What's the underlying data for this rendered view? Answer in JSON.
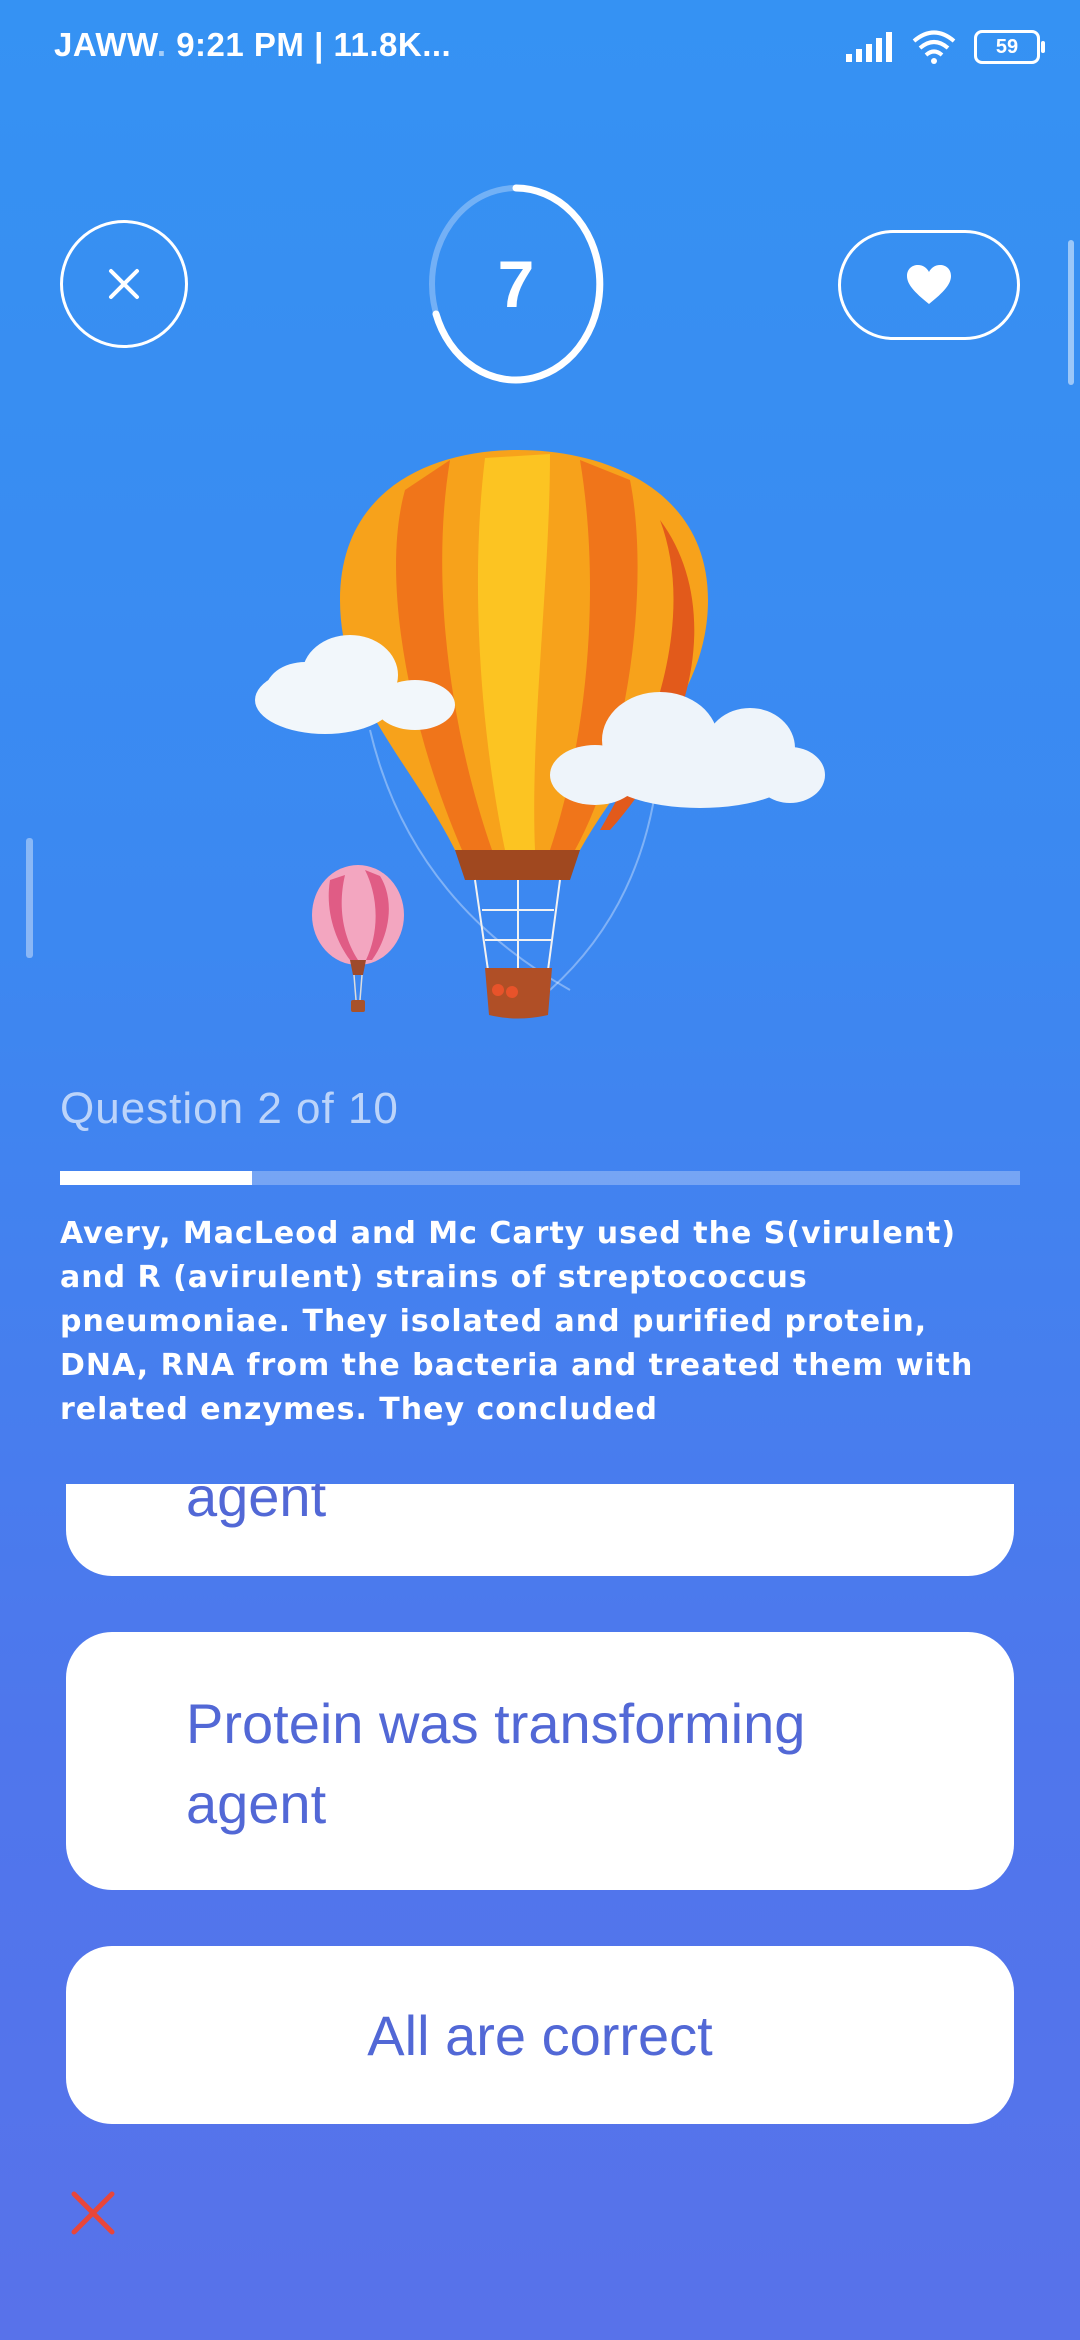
{
  "status_bar": {
    "carrier": "JAWW",
    "carrier_faded": ".",
    "time_info": "9:21 PM | 11.8K...",
    "battery": "59"
  },
  "header": {
    "timer_value": "7"
  },
  "quiz": {
    "counter": "Question 2 of 10",
    "progress_fraction": 0.2,
    "question": "Avery, MacLeod and Mc Carty used the S(virulent) and R (avirulent) strains of streptococcus pneumoniae. They isolated and purified protein, DNA, RNA from the bacteria and treated them with related enzymes. They concluded"
  },
  "options": [
    {
      "label": "agent"
    },
    {
      "label": "Protein was transforming agent"
    },
    {
      "label": "All are correct"
    }
  ],
  "colors": {
    "accent": "#5268d6",
    "wrong": "#e8463a",
    "background_top": "#3592f3",
    "background_bottom": "#5872ea"
  }
}
